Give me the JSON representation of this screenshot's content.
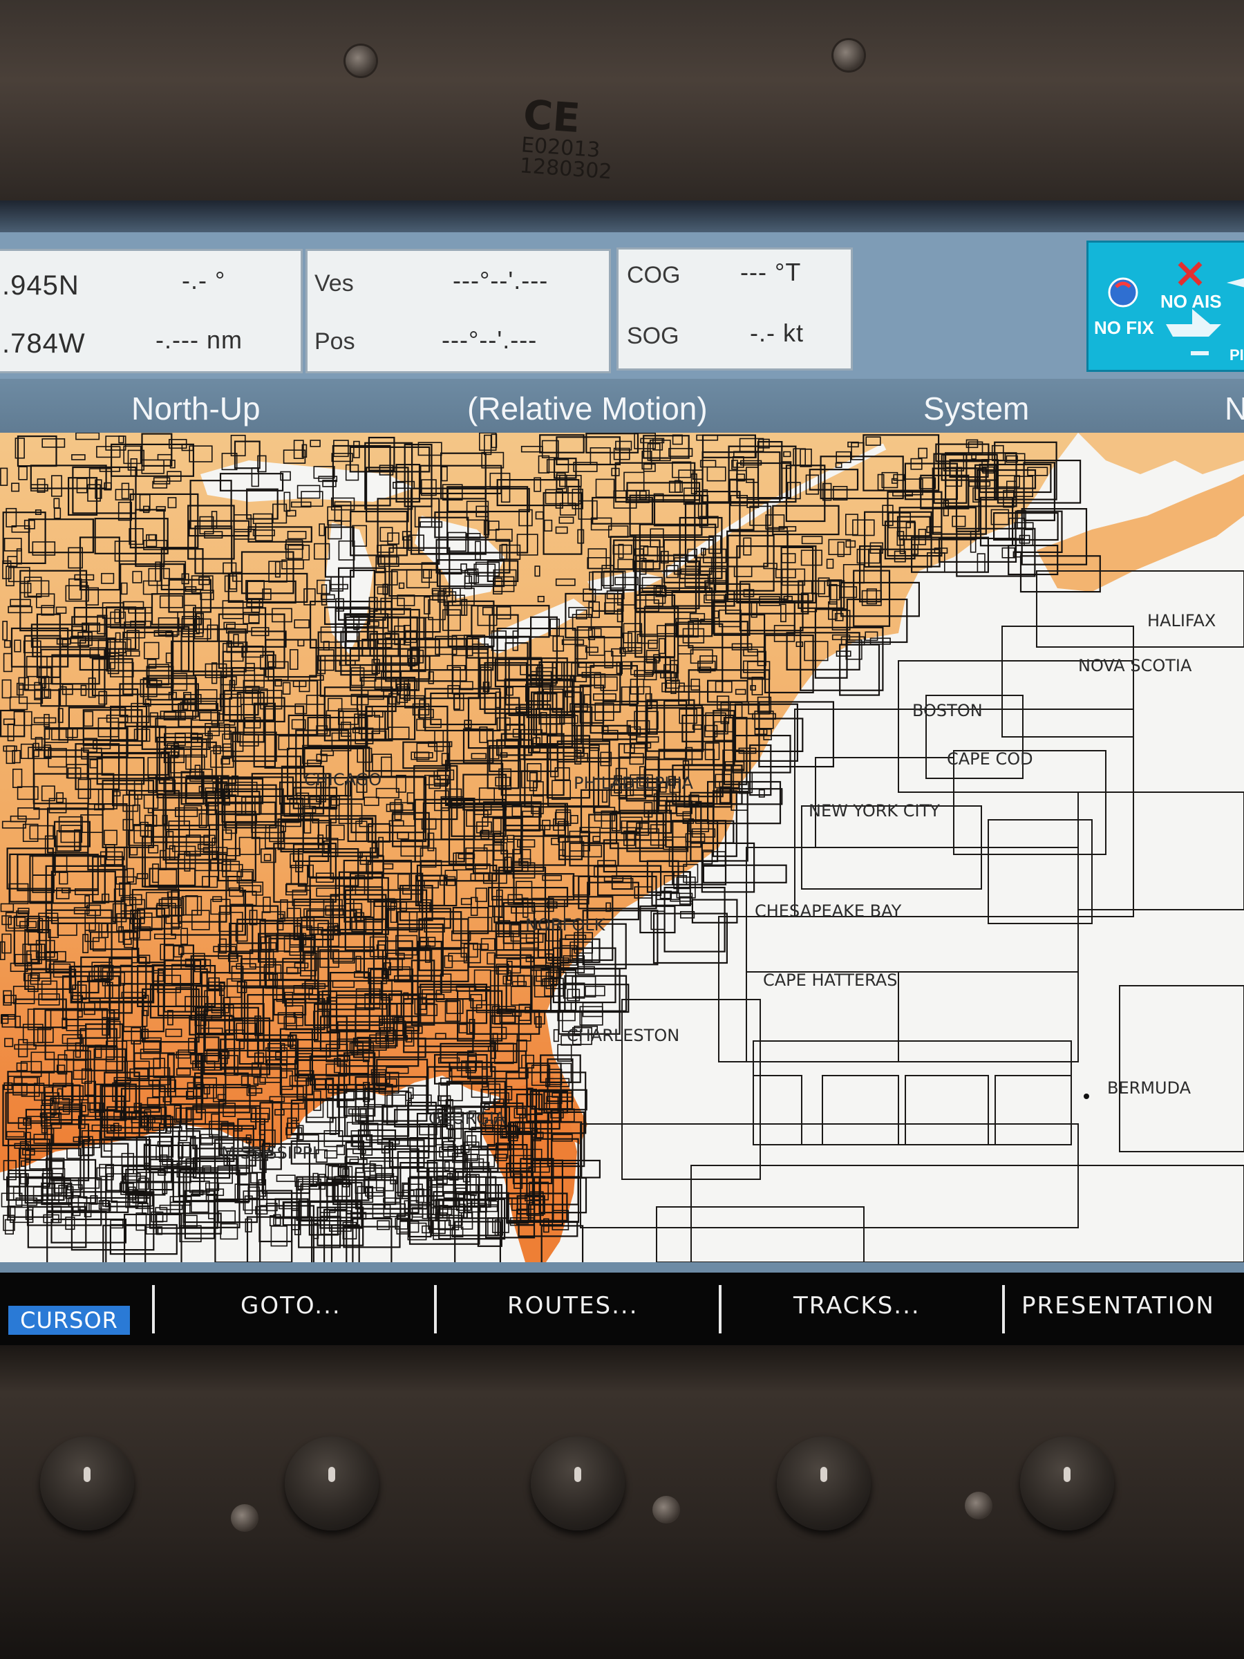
{
  "device": {
    "ce_mark": "CE",
    "model_code_line1": "E02013",
    "model_code_line2": "1280302"
  },
  "databar": {
    "latitude": ".945N",
    "longitude": ".784W",
    "range_top": "-.- °",
    "range_bottom": "-.--- nm",
    "ves_label": "Ves",
    "ves_value": "---°--'.---",
    "pos_label": "Pos",
    "pos_value": "---°--'.---",
    "cog_label": "COG",
    "cog_value": "--- °T",
    "sog_label": "SOG",
    "sog_value": "-.- kt"
  },
  "status": {
    "ais_text": "NO AIS",
    "fix_text": "NO FIX",
    "pi_text": "PI"
  },
  "header": {
    "orientation": "North-Up",
    "motion": "(Relative Motion)",
    "mode": "System",
    "cut_text": "N"
  },
  "chart": {
    "labels": {
      "halifax": "HALIFAX",
      "nova_scotia": "NOVA SCOTIA",
      "boston": "BOSTON",
      "cape_cod": "CAPE COD",
      "new_york_city": "NEW YORK CITY",
      "chesapeake_bay": "CHESAPEAKE BAY",
      "cape_hatteras": "CAPE HATTERAS",
      "bermuda": "BERMUDA",
      "georgia": "GEORGIA",
      "mississippi": "MISSISSIPPI",
      "chicago": "CHICAGO",
      "philadelphia": "PHILADELPHIA",
      "norfolk": "NORFOLK",
      "charleston": "CHARLESTON"
    },
    "colors": {
      "land_top": "#f3c27e",
      "land_bottom": "#ef8a3c",
      "sea": "#f4f4f2",
      "lines": "#151210"
    }
  },
  "softkeys": {
    "cursor": "CURSOR",
    "goto": "GOTO...",
    "routes": "ROUTES...",
    "tracks": "TRACKS...",
    "presentation": "PRESENTATION"
  }
}
